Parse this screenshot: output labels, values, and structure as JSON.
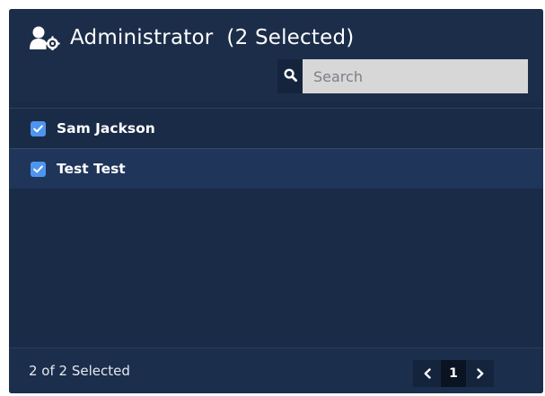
{
  "header": {
    "title": "Administrator",
    "selected_suffix": "(2 Selected)",
    "title_icon": "users-cog-icon"
  },
  "search": {
    "placeholder": "Search",
    "value": "",
    "icon": "search-icon"
  },
  "list": {
    "items": [
      {
        "label": "Sam Jackson",
        "checked": true
      },
      {
        "label": "Test Test",
        "checked": true
      }
    ]
  },
  "footer": {
    "status": "2 of 2 Selected",
    "current_page": "1"
  },
  "colors": {
    "panel": "#1a2b47",
    "selected_row": "#1f355a",
    "checkbox": "#4e95ee",
    "search_field": "#d7d7d7"
  }
}
